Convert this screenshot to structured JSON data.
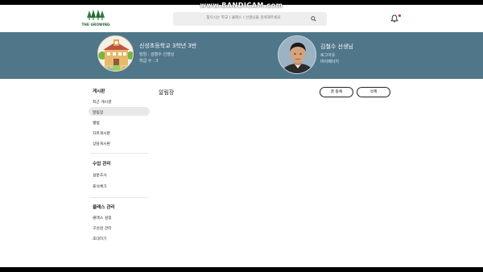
{
  "watermark": "www.BANDICAM.com",
  "header": {
    "logo_text": "THE GROWING",
    "search_placeholder": "찾으시는 학교 / 클래스 / 선생님을 검색해주세요"
  },
  "banner": {
    "school_title": "신성초등학교 3학년 3반",
    "homeroom": "담임 : 김철수 선생님",
    "students": "학급 수 : 3",
    "teacher_name": "김철수 선생님",
    "logout": "로그아웃",
    "mypage": "마이페이지"
  },
  "sidebar": {
    "board_heading": "게시판",
    "board_items": [
      "최근 게시글",
      "알림장",
      "앨범",
      "자유게시판",
      "상담게시판"
    ],
    "class_heading": "수업 관리",
    "class_items": [
      "설문조사",
      "출석체크"
    ],
    "manage_heading": "클래스 관리",
    "manage_items": [
      "클래스 설정",
      "구성원 관리",
      "초대하기"
    ]
  },
  "main": {
    "title": "알림장",
    "write_button": "글 등록",
    "delete_button": "삭제"
  },
  "colors": {
    "banner": "#4f7689",
    "logo_green": "#1f5e2f",
    "notification_dot": "#d2232a"
  }
}
